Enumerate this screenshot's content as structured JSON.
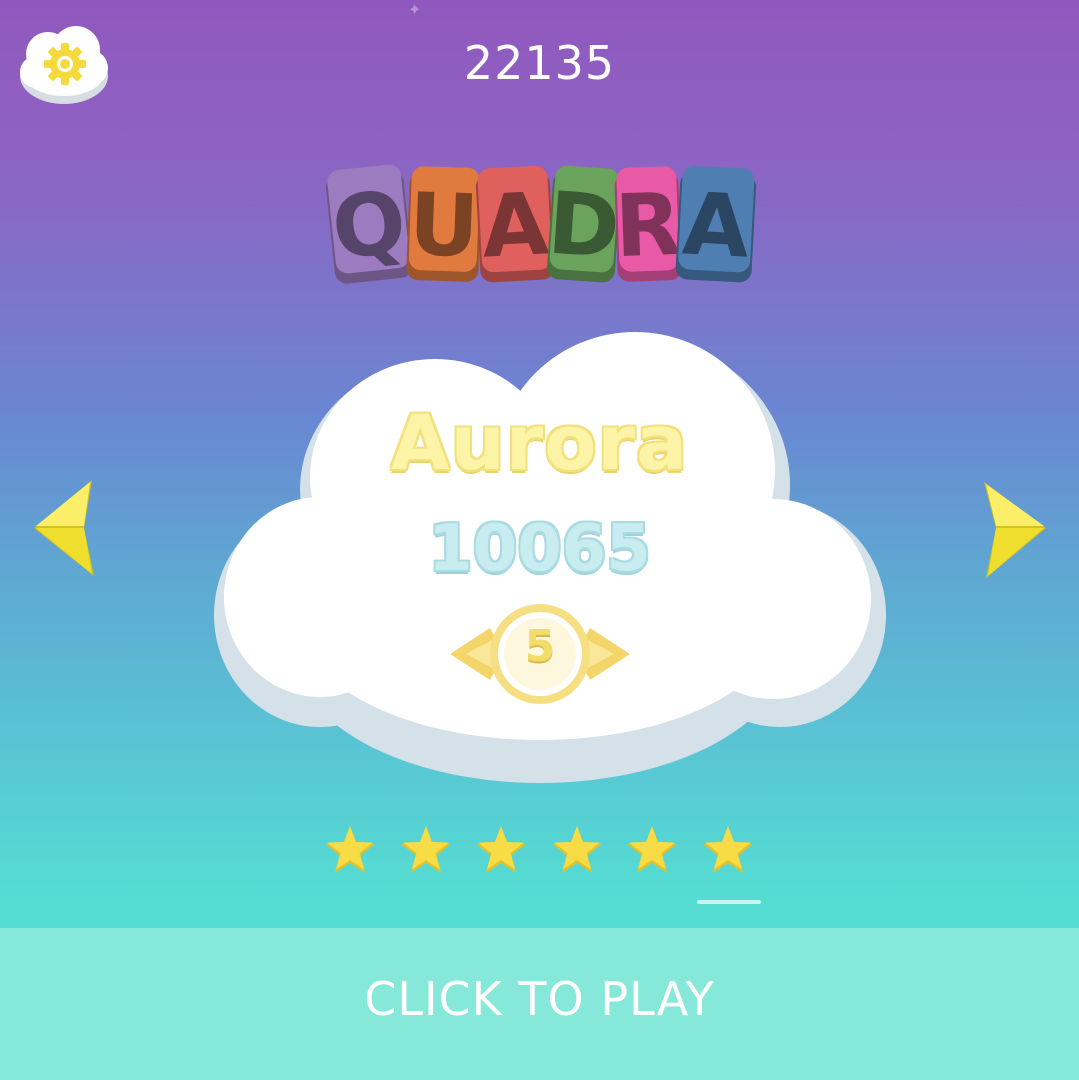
{
  "hud": {
    "settings_icon": "gear-icon",
    "total_score": "22135"
  },
  "logo": {
    "letters": [
      "Q",
      "U",
      "A",
      "D",
      "R",
      "A"
    ],
    "colors": [
      "#9c7bc0",
      "#e07a3f",
      "#e0605e",
      "#6aa35c",
      "#e85aa6",
      "#4f7fb2"
    ]
  },
  "level_card": {
    "name": "Aurora",
    "score": "10065",
    "rank": "5"
  },
  "navigation": {
    "prev_icon": "arrow-left-icon",
    "next_icon": "arrow-right-icon"
  },
  "stars": {
    "earned": 6,
    "total": 6
  },
  "play": {
    "label": "CLICK TO PLAY"
  },
  "colors": {
    "star": "#f7dc45",
    "arrow": "#f2e23a",
    "play_bar": "#85e8d8"
  }
}
